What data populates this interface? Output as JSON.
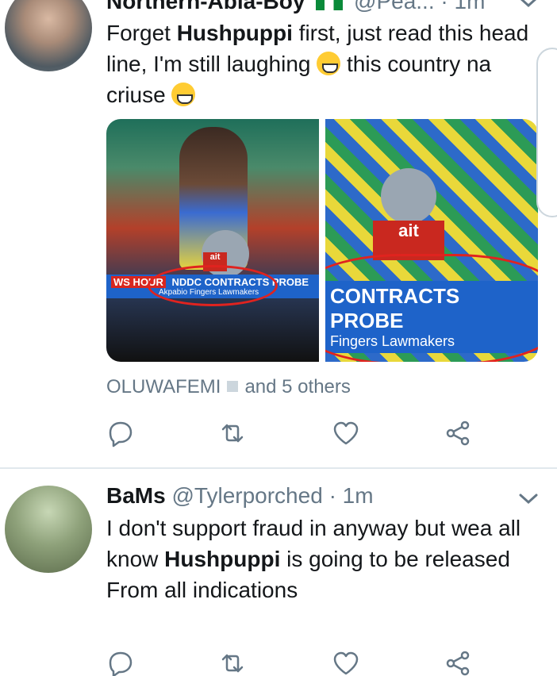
{
  "tweet1": {
    "name": "Northern-Abia-Boy",
    "handle": "@Pea...",
    "time": "· 1m",
    "text_1": "Forget ",
    "text_bold": "Hushpuppi",
    "text_2": " first, just read this head line, I'm still laughing ",
    "text_3": " this country na criuse ",
    "media_left": {
      "ticker_brand": "WS HOUR",
      "ticker_title": "NDDC CONTRACTS PROBE",
      "ticker_sub": "Akpabio Fingers Lawmakers",
      "mic_label": "ait"
    },
    "media_right": {
      "ticker_title": "CONTRACTS PROBE",
      "ticker_sub": "Fingers Lawmakers",
      "mic_label": "ait"
    },
    "liked_by": "OLUWAFEMI",
    "liked_others": "and 5 others"
  },
  "tweet2": {
    "name": "BaMs",
    "handle": "@Tylerporched",
    "time": "· 1m",
    "text_1": "I don't support fraud in anyway but wea all know ",
    "text_bold": "Hushpuppi",
    "text_2": " is going to be released",
    "text_3": "From all indications"
  },
  "icons": {
    "reply": "reply-icon",
    "retweet": "retweet-icon",
    "like": "heart-icon",
    "share": "share-icon",
    "caret": "chevron-down-icon"
  },
  "colors": {
    "secondary_text": "#657786",
    "action_icon": "#657786",
    "divider": "#e1e8ed",
    "ticker_blue": "#1e63c9",
    "highlight_red": "#e0231f"
  }
}
